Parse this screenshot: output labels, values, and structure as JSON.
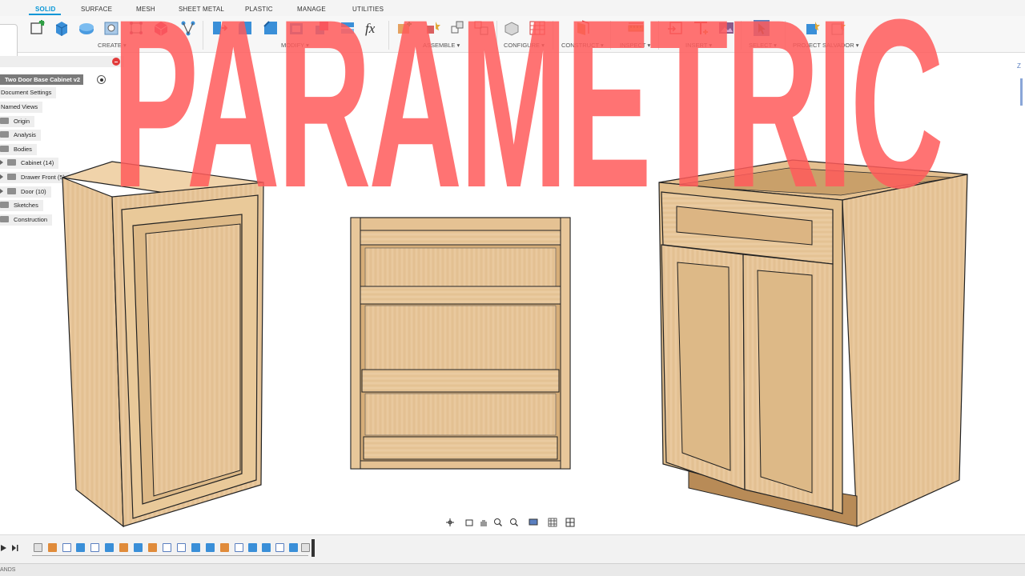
{
  "toolbar": {
    "tabs": [
      "SOLID",
      "SURFACE",
      "MESH",
      "SHEET METAL",
      "PLASTIC",
      "MANAGE",
      "UTILITIES"
    ],
    "active_tab": "SOLID",
    "groups": [
      "CREATE ▾",
      "MODIFY ▾",
      "ASSEMBLE ▾",
      "CONFIGURE ▾",
      "CONSTRUCT ▾",
      "INSPECT ▾",
      "INSERT ▾",
      "SELECT ▾",
      "PROJECT SALVADOR ▾"
    ],
    "fx_label": "fx"
  },
  "browser": {
    "document_name": "Two Door Base Cabinet v2",
    "items": [
      {
        "label": "Document Settings"
      },
      {
        "label": "Named Views"
      },
      {
        "label": "Origin"
      },
      {
        "label": "Analysis"
      },
      {
        "label": "Bodies"
      },
      {
        "label": "Cabinet (14)"
      },
      {
        "label": "Drawer Front (5)"
      },
      {
        "label": "Door (10)"
      },
      {
        "label": "Sketches"
      },
      {
        "label": "Construction"
      }
    ]
  },
  "overlay": {
    "title": "PARAMETRIC"
  },
  "viewcube": {
    "axis_label": "Z"
  },
  "status": {
    "text": "ANDS"
  },
  "colors": {
    "accent": "#0696d7",
    "overlay": "#ff5a5a",
    "wood_light": "#e8c79a",
    "wood_mid": "#d9b27e",
    "wood_dark": "#c79a63"
  }
}
